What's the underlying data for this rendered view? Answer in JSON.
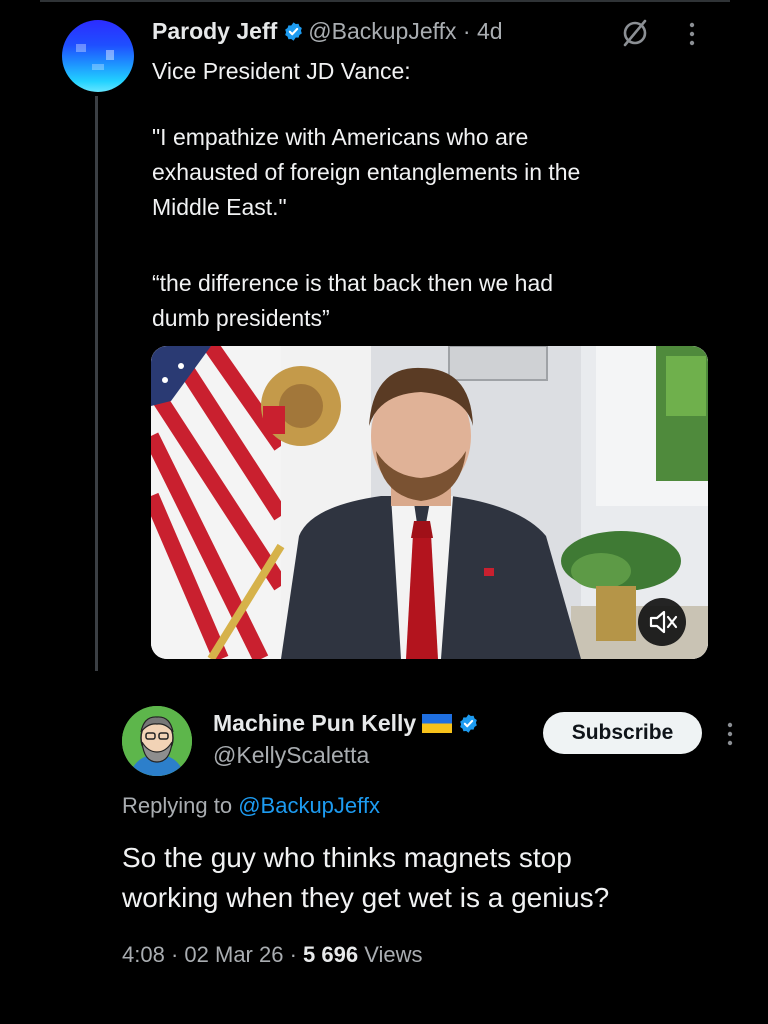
{
  "tweet": {
    "author_name": "Parody Jeff",
    "author_handle": "@BackupJeffx",
    "separator": "·",
    "time_ago": "4d",
    "line1": "Vice President JD Vance:",
    "quote1": "\"I empathize with Americans who are\nexhausted  of foreign entanglements in the\nMiddle East.\"",
    "quote2": "“the difference is that back then we had\ndumb presidents”"
  },
  "reply": {
    "author_name": "Machine Pun Kelly",
    "author_handle": "@KellyScaletta",
    "subscribe_label": "Subscribe",
    "replying_prefix": "Replying to",
    "replying_handle": "@BackupJeffx",
    "line1": "So the guy who thinks magnets stop",
    "line2": "working when they get wet is a genius?",
    "time": "4:08",
    "date": "02 Mar 26",
    "views_count": "5 696",
    "views_label": "Views",
    "sep": "·"
  },
  "icons": {
    "verified": "verified-badge-icon",
    "grok": "grok-icon",
    "more": "more-icon",
    "mute": "mute-icon",
    "flag": "ukraine-flag-icon"
  },
  "colors": {
    "background": "#000000",
    "text": "#e7e9ea",
    "secondary": "#a9adb1",
    "link": "#1d9bf0",
    "verified": "#1d9bf0"
  }
}
